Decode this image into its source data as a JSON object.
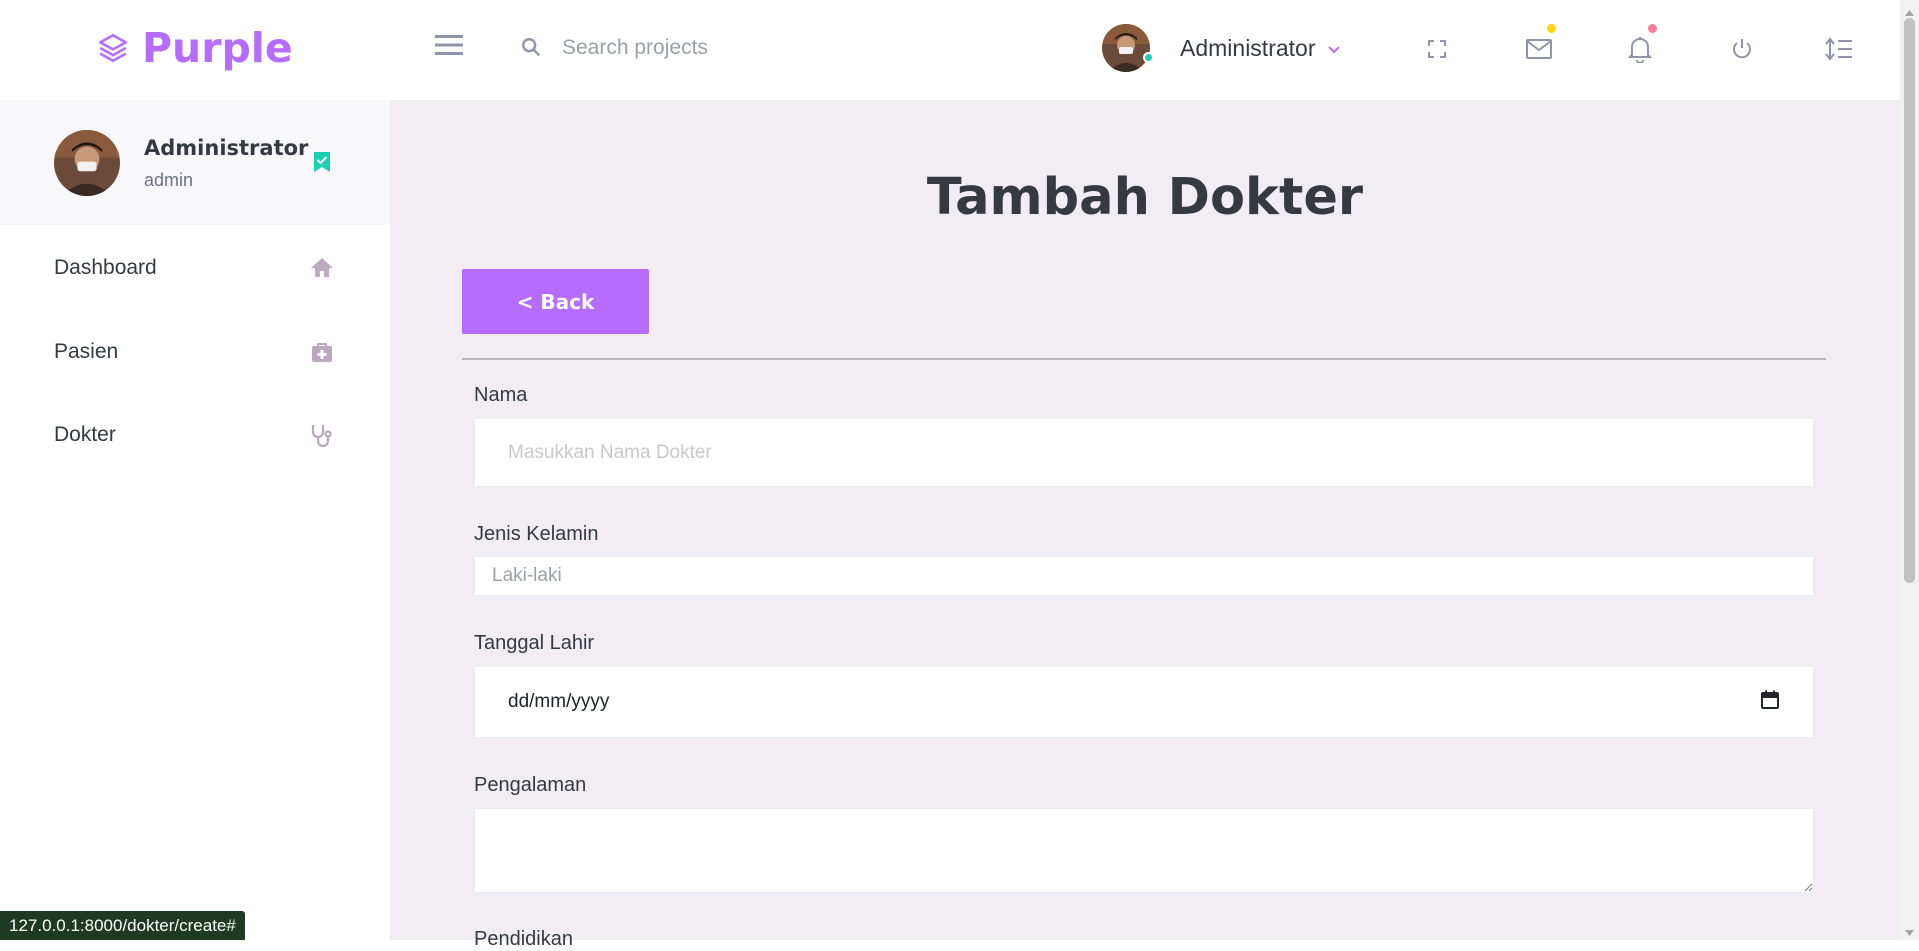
{
  "brand": {
    "name": "Purple"
  },
  "search": {
    "placeholder": "Search projects"
  },
  "navbar": {
    "profile_name": "Administrator",
    "colors": {
      "mail_badge": "#fed713",
      "bell_badge": "#fe7c96",
      "online": "#1bcfb4"
    }
  },
  "sidebar": {
    "profile": {
      "name": "Administrator",
      "role": "admin"
    },
    "items": [
      {
        "label": "Dashboard",
        "icon": "home-icon"
      },
      {
        "label": "Pasien",
        "icon": "medical-bag-icon"
      },
      {
        "label": "Dokter",
        "icon": "stethoscope-icon"
      }
    ]
  },
  "page": {
    "title": "Tambah Dokter",
    "back_label": "< Back"
  },
  "form": {
    "name_label": "Nama",
    "name_placeholder": "Masukkan Nama Dokter",
    "gender_label": "Jenis Kelamin",
    "gender_value": "Laki-laki",
    "dob_label": "Tanggal Lahir",
    "dob_placeholder": "dd/mm/yyyy",
    "experience_label": "Pengalaman",
    "education_label": "Pendidikan"
  },
  "status_bar": {
    "url": "127.0.0.1:8000/dokter/create#"
  },
  "colors": {
    "accent": "#b66dff",
    "content_bg": "#f2edf3"
  }
}
